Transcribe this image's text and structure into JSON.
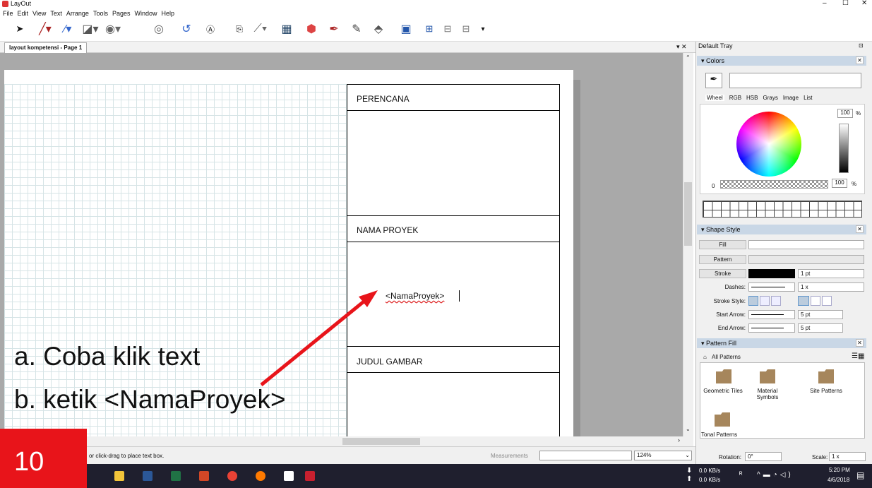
{
  "app": {
    "title": "LayOut",
    "window_controls": {
      "minimize": "–",
      "maximize": "☐",
      "close": "✕"
    }
  },
  "menu": [
    "File",
    "Edit",
    "View",
    "Text",
    "Arrange",
    "Tools",
    "Pages",
    "Window",
    "Help"
  ],
  "document": {
    "tab_label": "layout kompetensi - Page 1",
    "tab_controls": "▾ ✕"
  },
  "title_block": {
    "row1": "PERENCANA",
    "row2": "NAMA PROYEK",
    "placeholder_text": "<NamaProyek>",
    "row3": "JUDUL GAMBAR"
  },
  "status": {
    "hint": "or click-drag to place text box.",
    "measurements_label": "Measurements",
    "zoom": "124%"
  },
  "tray": {
    "title": "Default Tray",
    "colors": {
      "title": "Colors",
      "tabs": [
        "Wheel",
        "RGB",
        "HSB",
        "Grays",
        "Image",
        "List"
      ],
      "brightness": "100",
      "percent": "%",
      "opacity_min": "0",
      "opacity": "100"
    },
    "shape_style": {
      "title": "Shape Style",
      "fill": "Fill",
      "pattern": "Pattern",
      "stroke": "Stroke",
      "stroke_width": "1 pt",
      "dashes_label": "Dashes:",
      "dashes_scale": "1 x",
      "stroke_style_label": "Stroke Style:",
      "start_arrow_label": "Start Arrow:",
      "start_arrow_size": "5 pt",
      "end_arrow_label": "End Arrow:",
      "end_arrow_size": "5 pt"
    },
    "pattern_fill": {
      "title": "Pattern Fill",
      "collection": "All Patterns",
      "folders": [
        "Geometric Tiles",
        "Material Symbols",
        "Site Patterns",
        "Tonal Patterns"
      ]
    },
    "rotation_label": "Rotation:",
    "rotation_value": "0°",
    "scale_label": "Scale:",
    "scale_value": "1 x"
  },
  "annotation": {
    "line_a": "a.   Coba klik text",
    "line_b": "b.   ketik <NamaProyek>",
    "slide_number": "10",
    "arrow_color": "#e8141a"
  },
  "taskbar": {
    "net_down": "0.0 KB/s",
    "net_up": "0.0 KB/s",
    "time": "5:20 PM",
    "date": "4/6/2018"
  },
  "colors": {
    "panel_header": "#c9d7e6",
    "canvas_bg": "#a9a9a9",
    "grid": "#d6e4e6",
    "badge": "#e8141a"
  }
}
